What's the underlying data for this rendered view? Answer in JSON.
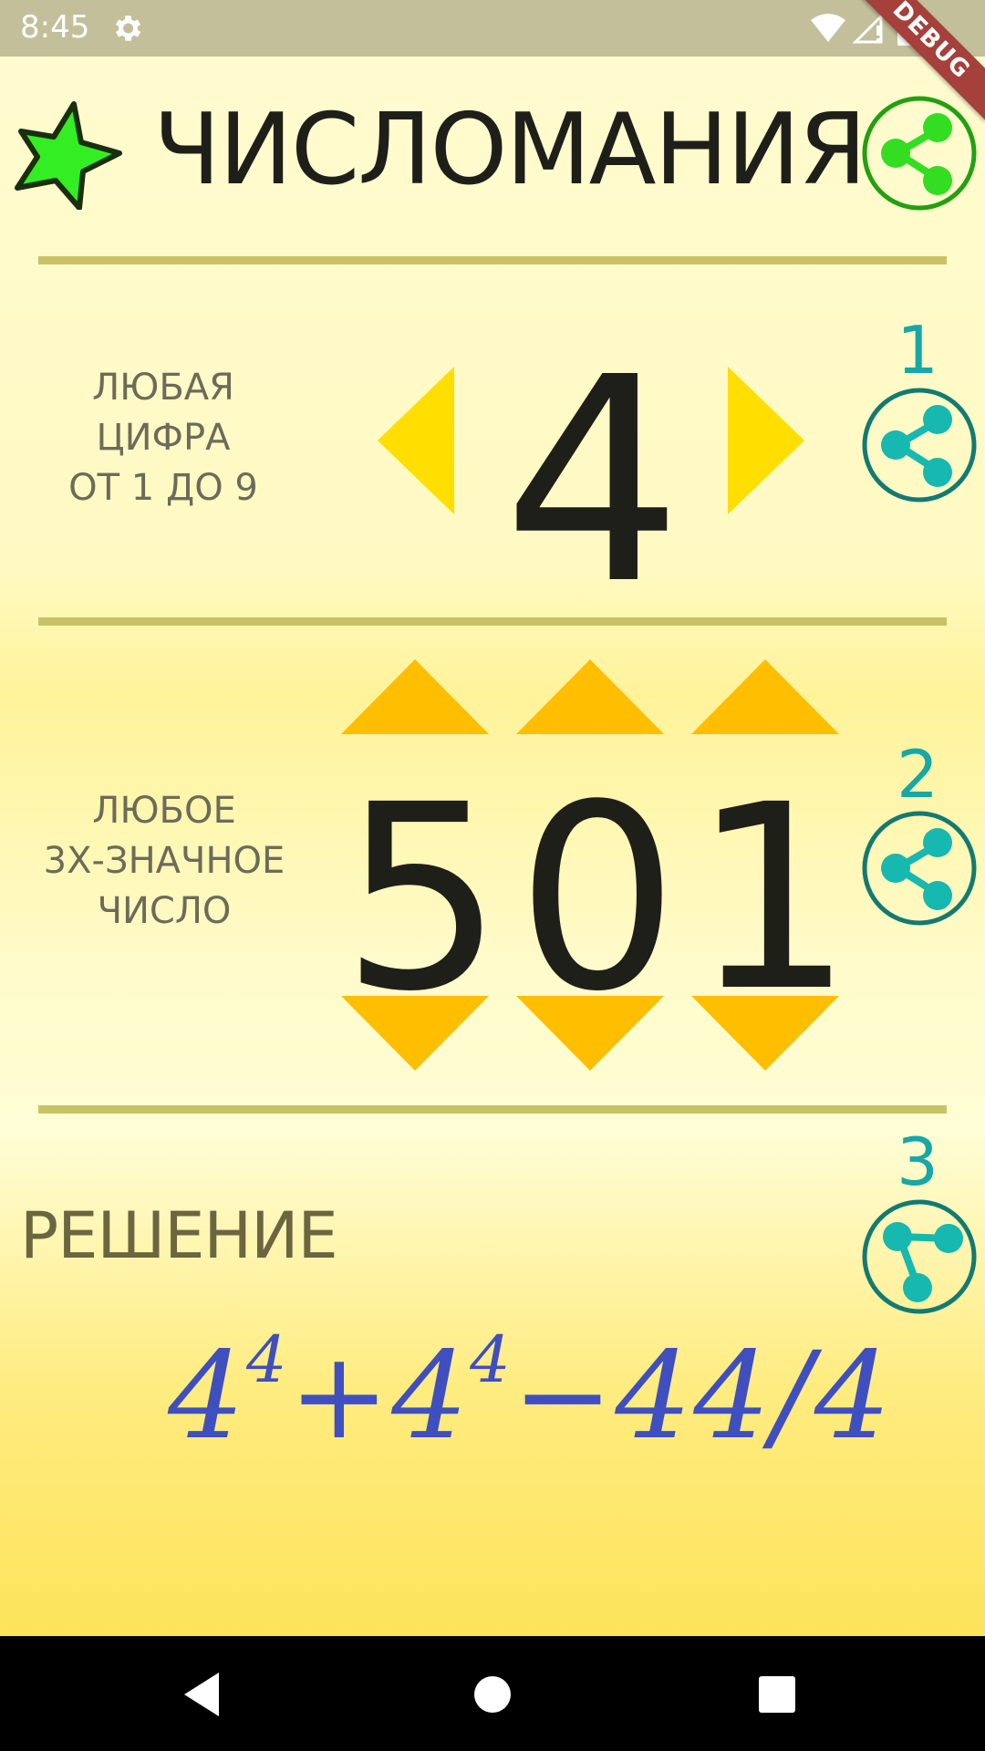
{
  "status_bar": {
    "time": "8:45",
    "icons": [
      "gear-icon",
      "wifi-icon",
      "signal-icon",
      "battery-icon"
    ]
  },
  "debug_banner": "DEBUG",
  "header": {
    "title": "ЧИСЛОМАНИЯ",
    "star_color": "#33ee22",
    "share_color": "#22c010"
  },
  "section1": {
    "number": "1",
    "label": [
      "ЛЮБАЯ",
      "ЦИФРА",
      "ОТ 1 ДО 9"
    ],
    "digit": "4",
    "arrow_color": "#ffde00"
  },
  "section2": {
    "number": "2",
    "label": [
      "ЛЮБОЕ",
      "3Х-ЗНАЧНОЕ",
      "ЧИСЛО"
    ],
    "digits": [
      "5",
      "0",
      "1"
    ],
    "arrow_color": "#ffbe00"
  },
  "section3": {
    "number": "3",
    "label": "РЕШЕНИЕ",
    "solution": {
      "b1": "4",
      "e1": "4",
      "op1": "+",
      "b2": "4",
      "e2": "4",
      "rest": "−44/4"
    }
  },
  "colors": {
    "accent_teal": "#16a8a6",
    "divider": "#c8c267"
  },
  "navbar": {
    "icons": [
      "back-icon",
      "home-icon",
      "recents-icon"
    ]
  }
}
